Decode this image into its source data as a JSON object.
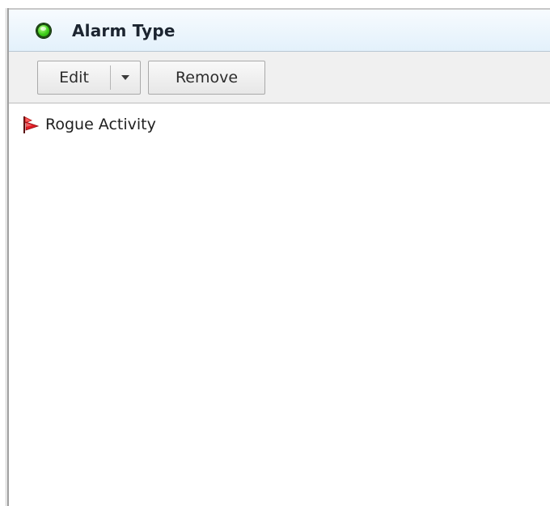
{
  "panel": {
    "title": "Alarm Type",
    "status": "green"
  },
  "toolbar": {
    "edit_label": "Edit",
    "remove_label": "Remove"
  },
  "list": {
    "items": [
      {
        "label": "Rogue Activity",
        "icon": "red-flag-icon"
      }
    ]
  },
  "colors": {
    "header_bg": "#e3f1fb",
    "toolbar_bg": "#f0f0f0",
    "status_green": "#3fcf1b",
    "flag_red": "#e01c24"
  }
}
